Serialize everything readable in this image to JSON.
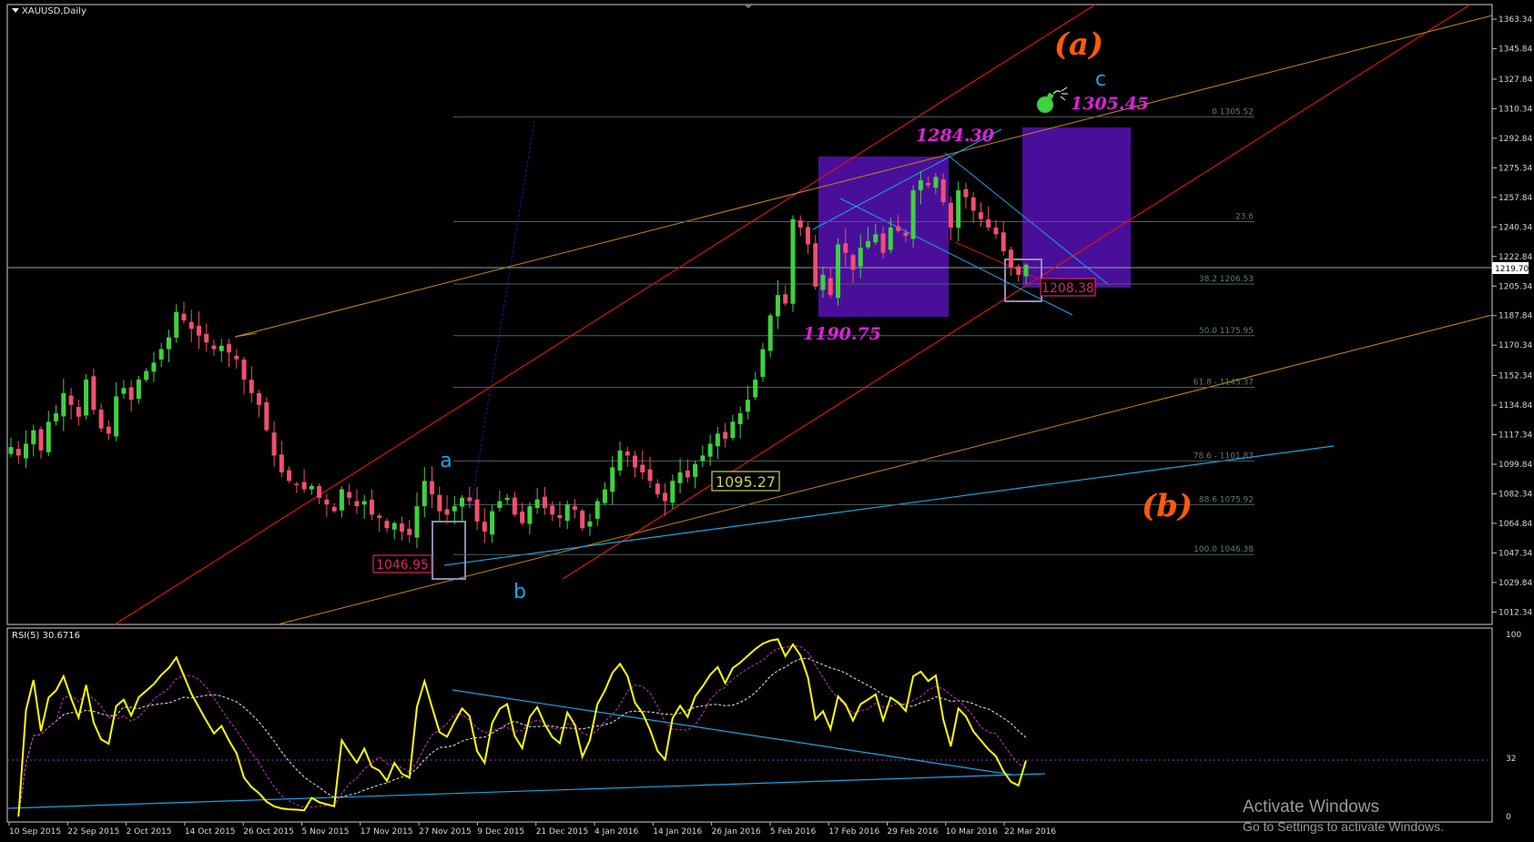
{
  "chart_title": "XAUUSD,Daily",
  "rsi_label": "RSI(5) 30.6716",
  "current_price_label": "1219.70",
  "price_axis_labels": [
    "1363.34",
    "1345.84",
    "1327.84",
    "1310.34",
    "1292.84",
    "1275.34",
    "1257.84",
    "1240.34",
    "1222.84",
    "1205.34",
    "1187.84",
    "1170.34",
    "1152.34",
    "1134.84",
    "1117.34",
    "1099.84",
    "1082.34",
    "1064.84",
    "1047.34",
    "1029.84",
    "1012.34"
  ],
  "rsi_axis_labels": [
    "100",
    "32",
    "0"
  ],
  "date_labels": [
    "10 Sep 2015",
    "22 Sep 2015",
    "2 Oct 2015",
    "14 Oct 2015",
    "26 Oct 2015",
    "5 Nov 2015",
    "17 Nov 2015",
    "27 Nov 2015",
    "9 Dec 2015",
    "21 Dec 2015",
    "4 Jan 2016",
    "14 Jan 2016",
    "26 Jan 2016",
    "5 Feb 2016",
    "17 Feb 2016",
    "29 Feb 2016",
    "10 Mar 2016",
    "22 Mar 2016"
  ],
  "fib_levels": [
    {
      "label": "0 1305.52",
      "price": 1305.52
    },
    {
      "label": "23.6",
      "price": 1243.5
    },
    {
      "label": "38.2 1206.53",
      "price": 1206.53
    },
    {
      "label": "50.0 1175.95",
      "price": 1175.95
    },
    {
      "label": "61.8 - 1145.37",
      "price": 1145.37
    },
    {
      "label": "78.6 - 1101.83",
      "price": 1101.83
    },
    {
      "label": "88.6 1075.92",
      "price": 1075.92
    },
    {
      "label": "100.0 1046.38",
      "price": 1046.38
    }
  ],
  "annotations": {
    "wave_a_big": "(a)",
    "wave_b_big": "(b)",
    "wave_c": "c",
    "wave_a": "a",
    "wave_b": "b",
    "target": "1305.45",
    "high": "1284.30",
    "low_feb": "1190.75",
    "low_nov": "1046.95",
    "level_jan": "1095.27",
    "current_box": "1208.38"
  },
  "watermark": {
    "line1": "Activate Windows",
    "line2": "Go to Settings to activate Windows."
  },
  "colors": {
    "up": "#3fd13f",
    "down": "#f0506e",
    "rsi": "#ffff00",
    "fib": "#5d7a7a",
    "box": "#4b0f9c",
    "channel": "#ff1a1a",
    "trend": "#e0a000",
    "blue": "#14a8e6"
  },
  "chart_data": {
    "type": "candlestick",
    "symbol": "XAUUSD",
    "timeframe": "Daily",
    "ylim": [
      1005,
      1372
    ],
    "approx_closes": [
      1110,
      1105,
      1112,
      1120,
      1108,
      1125,
      1130,
      1142,
      1135,
      1128,
      1150,
      1132,
      1121,
      1118,
      1140,
      1145,
      1138,
      1150,
      1155,
      1160,
      1168,
      1175,
      1190,
      1185,
      1180,
      1176,
      1172,
      1168,
      1170,
      1166,
      1162,
      1150,
      1142,
      1135,
      1120,
      1105,
      1095,
      1090,
      1088,
      1085,
      1087,
      1080,
      1076,
      1072,
      1085,
      1080,
      1075,
      1078,
      1070,
      1068,
      1062,
      1065,
      1060,
      1058,
      1075,
      1090,
      1082,
      1072,
      1070,
      1075,
      1080,
      1078,
      1066,
      1060,
      1072,
      1078,
      1080,
      1070,
      1065,
      1075,
      1079,
      1074,
      1070,
      1068,
      1076,
      1073,
      1062,
      1066,
      1078,
      1085,
      1098,
      1108,
      1105,
      1098,
      1095,
      1090,
      1082,
      1078,
      1090,
      1095,
      1092,
      1100,
      1105,
      1112,
      1118,
      1115,
      1125,
      1130,
      1138,
      1150,
      1168,
      1188,
      1200,
      1195,
      1245,
      1240,
      1230,
      1205,
      1212,
      1200,
      1230,
      1225,
      1215,
      1228,
      1232,
      1236,
      1225,
      1240,
      1238,
      1235,
      1262,
      1268,
      1265,
      1270,
      1255,
      1240,
      1262,
      1258,
      1250,
      1245,
      1240,
      1236,
      1226,
      1216,
      1212,
      1218
    ],
    "rsi_period": 5,
    "rsi_last": 30.6716,
    "rsi_ylim": [
      0,
      100
    ],
    "rsi_level": 32
  }
}
